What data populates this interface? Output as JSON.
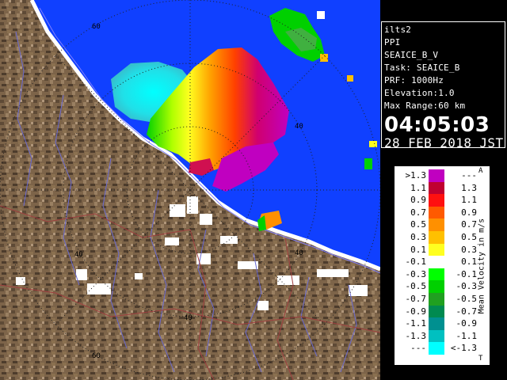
{
  "info": {
    "site": "ilts2",
    "mode": "PPI",
    "product": "SEAICE_B_V",
    "task": "Task: SEAICE_B",
    "prf": "PRF: 1000Hz",
    "elevation": "Elevation:1.0",
    "max_range": "Max Range:60 km",
    "time": "04:05:03",
    "date": "28 FEB 2018 JST"
  },
  "legend": {
    "title": "Mean Velocity in m/s",
    "top_cap": "A",
    "bottom_cap": "T",
    "rows": [
      {
        "lo": ">1.3",
        "hi": "---",
        "color": "#c000c0"
      },
      {
        "lo": "1.1",
        "hi": "1.3",
        "color": "#c00030"
      },
      {
        "lo": "0.9",
        "hi": "1.1",
        "color": "#ff1010"
      },
      {
        "lo": "0.7",
        "hi": "0.9",
        "color": "#ff5a00"
      },
      {
        "lo": "0.5",
        "hi": "0.7",
        "color": "#ff9000"
      },
      {
        "lo": "0.3",
        "hi": "0.5",
        "color": "#ffc000"
      },
      {
        "lo": "0.1",
        "hi": "0.3",
        "color": "#ffff20"
      },
      {
        "lo": "-0.1",
        "hi": "0.1",
        "color": "#ffffff"
      },
      {
        "lo": "-0.3",
        "hi": "-0.1",
        "color": "#00ff00"
      },
      {
        "lo": "-0.5",
        "hi": "-0.3",
        "color": "#00d000"
      },
      {
        "lo": "-0.7",
        "hi": "-0.5",
        "color": "#20a020"
      },
      {
        "lo": "-0.9",
        "hi": "-0.7",
        "color": "#008a50"
      },
      {
        "lo": "-1.1",
        "hi": "-0.9",
        "color": "#009090"
      },
      {
        "lo": "-1.3",
        "hi": "-1.1",
        "color": "#00c0c0"
      },
      {
        "lo": "---",
        "hi": "<-1.3",
        "color": "#00ffff"
      }
    ]
  },
  "map": {
    "range_labels": [
      "60",
      "40",
      "40",
      "40",
      "60",
      "40"
    ],
    "colors": {
      "sea": "#1040ff",
      "land": "#7a6248",
      "snow": "#ffffff",
      "river": "#6a6ad0",
      "boundary": "#a04040"
    }
  }
}
